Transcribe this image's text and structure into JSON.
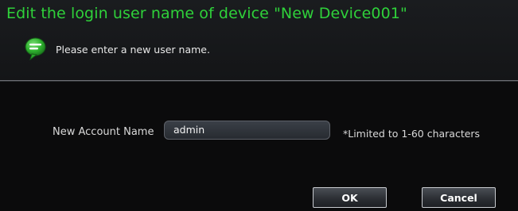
{
  "dialog": {
    "title": "Edit the login user name of device \"New Device001\"",
    "hint": "Please enter a new user name.",
    "hint_icon": "chat-bubble-icon"
  },
  "form": {
    "label": "New Account Name",
    "value": "admin",
    "limit_note": "*Limited to 1-60 characters"
  },
  "buttons": {
    "ok": "OK",
    "cancel": "Cancel"
  },
  "colors": {
    "title": "#2fd13a",
    "background": "#0b0b0c",
    "hint_icon": "#3ec23f"
  }
}
